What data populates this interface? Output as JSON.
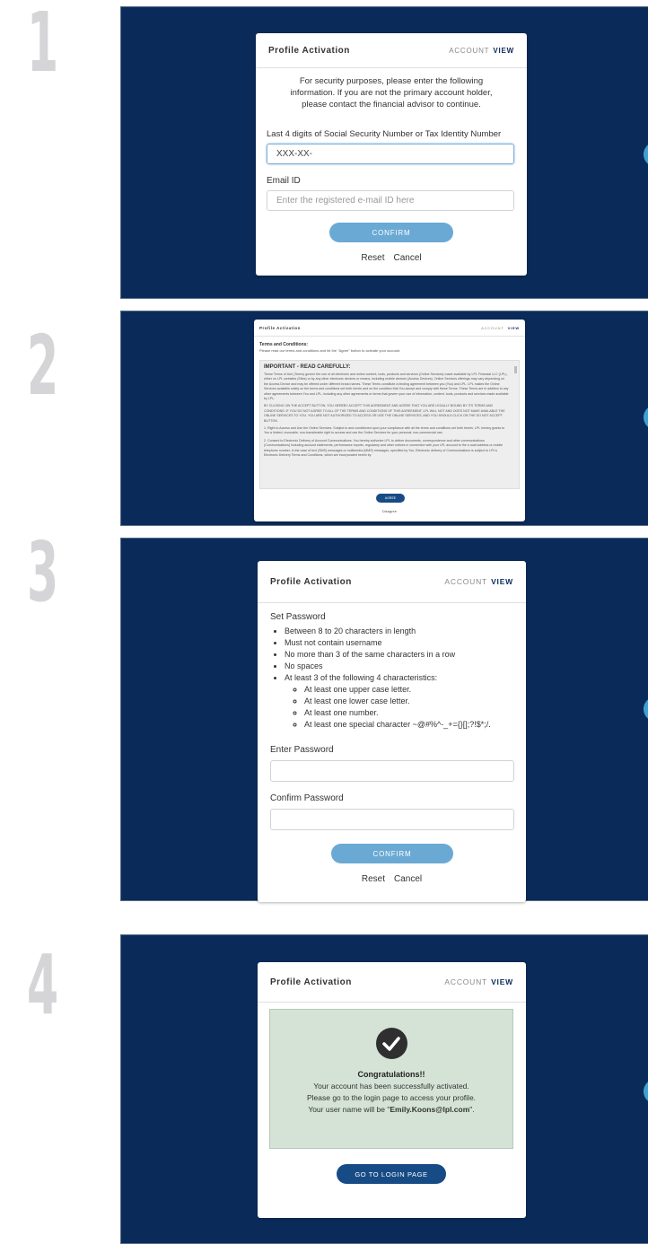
{
  "steps": [
    "1",
    "2",
    "3",
    "4"
  ],
  "header": {
    "title": "Profile Activation",
    "account": "ACCOUNT",
    "view": "VIEW"
  },
  "step1": {
    "intro": "For security purposes, please enter the following information. If you are not the primary account holder, please contact the financial advisor to continue.",
    "ssn_label": "Last 4 digits of Social Security Number or Tax Identity Number",
    "ssn_value": "XXX-XX-",
    "email_label": "Email ID",
    "email_placeholder": "Enter the registered e-mail ID here",
    "confirm": "CONFIRM",
    "reset": "Reset",
    "cancel": "Cancel"
  },
  "step2": {
    "heading": "Terms and Conditions:",
    "subheading": "Please read our terms and conditions and hit the \"Agree\" button to activate your account.",
    "important": "IMPORTANT - READ CAREFULLY:",
    "paragraphs": [
      "These Terms of Use (Terms) govern the use of all electronic and online content, tools, products and services (Online Services) made available by LPL Financial LLC (LPL), either on LPL websites (Sites) or by any other electronic devices or means, including mobile devices (Access Devices). Online Services offerings may vary depending on the Access Device and may be offered under different brand names. These Terms constitute a binding agreement between you (You) and LPL. LPL makes the Online Services available solely on the terms and conditions set forth herein and on the condition that You accept and comply with these Terms. These Terms are in addition to any other agreements between You and LPL, including any other agreements or terms that govern your use of information, content, tools, products and services made available by LPL.",
      "BY CLICKING ON THE ACCEPT BUTTON, YOU HEREBY ACCEPT THIS AGREEMENT AND AGREE THAT YOU ARE LEGALLY BOUND BY ITS TERMS AND CONDITIONS. IF YOU DO NOT AGREE TO ALL OF THE TERMS AND CONDITIONS OF THIS AGREEMENT, LPL WILL NOT AND DOES NOT MAKE AVAILABLE THE ONLINE SERVICES TO YOU. YOU ARE NOT AUTHORIZED TO ACCESS OR USE THE ONLINE SERVICES, AND YOU SHOULD CLICK ON THE DO NOT ACCEPT BUTTON.",
      "1. Right to Access and Use the Online Services. Subject to and conditioned upon your compliance with all the terms and conditions set forth herein, LPL hereby grants to You a limited, revocable, non-transferable right to access and use the Online Services for your personal, non-commercial use.",
      "2. Consent to Electronic Delivery of Account Communications. You hereby authorize LPL to deliver documents, correspondence and other communications (Communications) including account statements, performance reports, regulatory and other notices in connection with your LPL account to the e-mail address or mobile telephone number, in the case of text (SMS) messages or multimedia (MMS) messages, specified by You. Electronic delivery of Communications is subject to LPL's Electronic Delivery Terms and Conditions, which are incorporated herein by"
    ],
    "agree": "AGREE",
    "disagree": "Disagree"
  },
  "step3": {
    "set_password": "Set Password",
    "rules": [
      "Between 8 to 20 characters in length",
      "Must not contain username",
      "No more than 3 of the same characters in a row",
      "No spaces",
      "At least 3 of the following 4 characteristics:"
    ],
    "subrules": [
      "At least one upper case letter.",
      "At least one lower case letter.",
      "At least one number.",
      "At least one special character ~@#%^-_+={}[];?!$*;/."
    ],
    "enter_label": "Enter Password",
    "confirm_label": "Confirm Password",
    "confirm": "CONFIRM",
    "reset": "Reset",
    "cancel": "Cancel"
  },
  "step4": {
    "congrats": "Congratulations!!",
    "line1": "Your account has been successfully activated.",
    "line2": "Please go to the login page to access your profile.",
    "line3_prefix": "Your user name will be \"",
    "username": "Emily.Koons@lpl.com",
    "line3_suffix": "\".",
    "login_btn": "GO TO LOGIN PAGE"
  },
  "colors": {
    "panel": "#0a2b5a",
    "button": "#6aa9d4",
    "success_bg": "#d4e3d6",
    "dark_button": "#174b86"
  }
}
